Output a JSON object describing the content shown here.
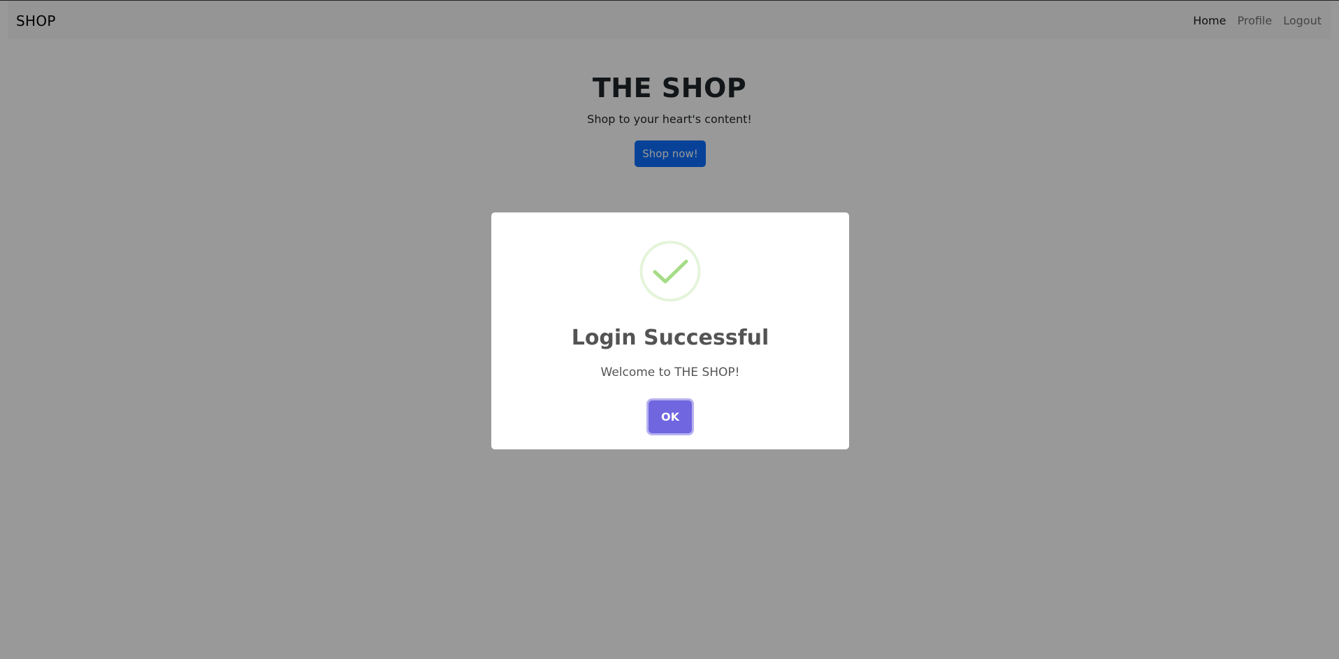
{
  "navbar": {
    "brand": "SHOP",
    "links": [
      {
        "label": "Home"
      },
      {
        "label": "Profile"
      },
      {
        "label": "Logout"
      }
    ]
  },
  "hero": {
    "title": "THE SHOP",
    "subtitle": "Shop to your heart's content!",
    "button_label": "Shop now!"
  },
  "modal": {
    "icon": "success-check-icon",
    "title": "Login Successful",
    "text": "Welcome to THE SHOP!",
    "ok_label": "OK"
  },
  "colors": {
    "primary": "#0d6efd",
    "confirm": "#7066e0",
    "success": "#a5dc86"
  }
}
